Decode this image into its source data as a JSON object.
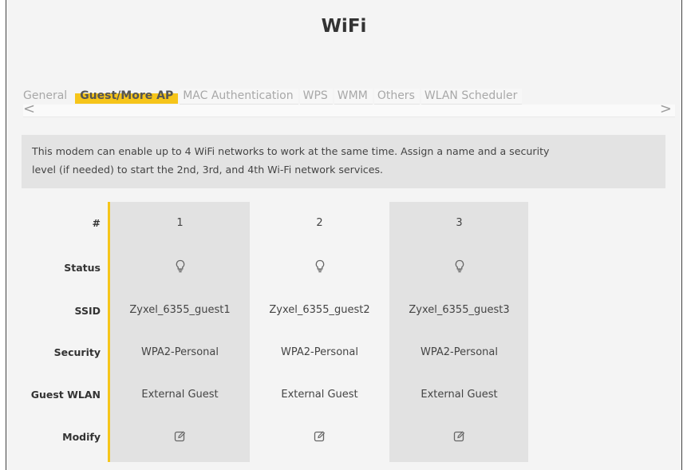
{
  "page": {
    "title": "WiFi"
  },
  "tabs": [
    {
      "label": "General",
      "active": false
    },
    {
      "label": "Guest/More AP",
      "active": true
    },
    {
      "label": "MAC Authentication",
      "active": false
    },
    {
      "label": "WPS",
      "active": false
    },
    {
      "label": "WMM",
      "active": false
    },
    {
      "label": "Others",
      "active": false
    },
    {
      "label": "WLAN Scheduler",
      "active": false
    }
  ],
  "scroll": {
    "left_glyph": "<",
    "right_glyph": ">"
  },
  "info": {
    "line1": "This modem can enable up to 4 WiFi networks to work at the same time. Assign a name and a security",
    "line2": "level (if needed) to start the 2nd, 3rd, and 4th Wi-Fi network services."
  },
  "table": {
    "row_labels": {
      "index": "#",
      "status": "Status",
      "ssid": "SSID",
      "security": "Security",
      "guest_wlan": "Guest WLAN",
      "modify": "Modify"
    },
    "rows": [
      {
        "index": "1",
        "status_icon": "lightbulb-icon",
        "ssid": "Zyxel_6355_guest1",
        "security": "WPA2-Personal",
        "guest_wlan": "External Guest",
        "modify_icon": "edit-icon"
      },
      {
        "index": "2",
        "status_icon": "lightbulb-icon",
        "ssid": "Zyxel_6355_guest2",
        "security": "WPA2-Personal",
        "guest_wlan": "External Guest",
        "modify_icon": "edit-icon"
      },
      {
        "index": "3",
        "status_icon": "lightbulb-icon",
        "ssid": "Zyxel_6355_guest3",
        "security": "WPA2-Personal",
        "guest_wlan": "External Guest",
        "modify_icon": "edit-icon"
      }
    ]
  },
  "colors": {
    "accent": "#f6c51a",
    "column_shade": "#e2e2e2",
    "info_bg": "#e3e3e3"
  }
}
